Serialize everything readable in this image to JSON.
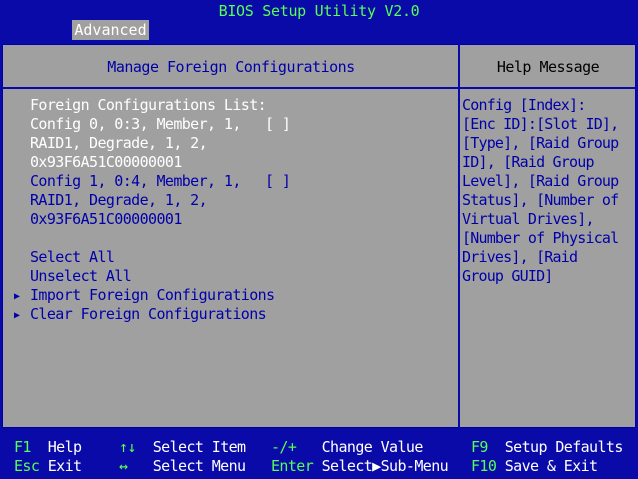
{
  "app": {
    "title": "BIOS Setup Utility V2.0"
  },
  "tabs": [
    {
      "label": "Advanced"
    }
  ],
  "panel": {
    "title": "Manage Foreign Configurations"
  },
  "help": {
    "title": "Help Message",
    "lines": [
      "Config [Index]:",
      "[Enc ID]:[Slot ID],",
      "[Type], [Raid Group",
      "ID], [Raid Group",
      "Level], [Raid Group",
      "Status], [Number of",
      "Virtual Drives],",
      "[Number of Physical",
      "Drives], [Raid",
      "Group GUID]"
    ]
  },
  "content": {
    "list_heading": "Foreign Configurations List:",
    "configs": [
      {
        "line1": "Config 0, 0:3, Member, 1,",
        "checkbox": "[ ]",
        "line2": "RAID1, Degrade, 1, 2,",
        "line3": "0x93F6A51C00000001"
      },
      {
        "line1": "Config 1, 0:4, Member, 1,",
        "checkbox": "[ ]",
        "line2": "RAID1, Degrade, 1, 2,",
        "line3": "0x93F6A51C00000001"
      }
    ],
    "select_all": "Select All",
    "unselect_all": "Unselect All",
    "import": "Import Foreign Configurations",
    "clear": "Clear Foreign Configurations",
    "submenu_icon": "right-triangle-icon"
  },
  "footer": {
    "left": [
      {
        "key": "F1",
        "desc": "Help"
      },
      {
        "key": "Esc",
        "desc": "Exit"
      }
    ],
    "mid": [
      {
        "key": "↑↓",
        "desc": "Select Item"
      },
      {
        "key": "↔",
        "desc": "Select Menu"
      }
    ],
    "right": [
      {
        "key": "-/+",
        "desc": "Change Value"
      },
      {
        "key": "Enter",
        "desc": "Select▶Sub-Menu"
      }
    ],
    "far": [
      {
        "key": "F9",
        "desc": "Setup Defaults"
      },
      {
        "key": "F10",
        "desc": "Save & Exit"
      }
    ]
  },
  "colors": {
    "background": "#0a0aa8",
    "panel": "#a0a0a0",
    "key_text": "#55ff55",
    "selected_text": "#ffffff",
    "item_text": "#0000aa"
  }
}
